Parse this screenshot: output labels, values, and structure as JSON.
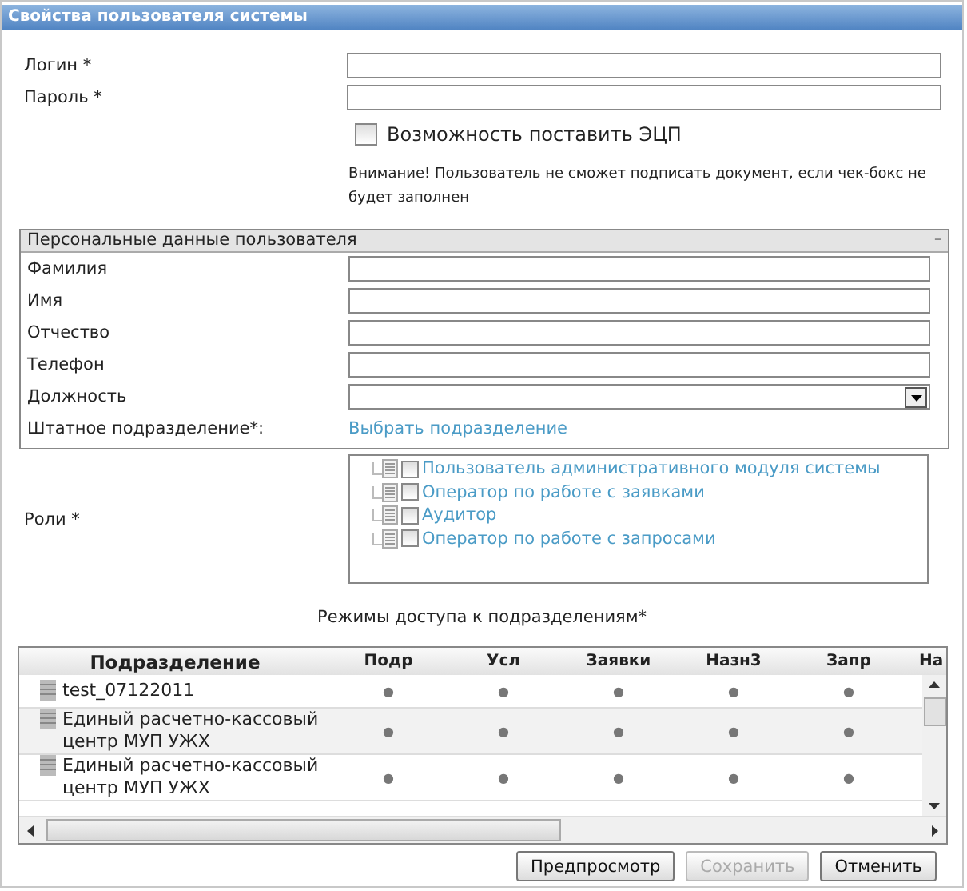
{
  "window": {
    "title": "Свойства пользователя системы"
  },
  "login": {
    "label": "Логин *"
  },
  "password": {
    "label": "Пароль *"
  },
  "signature": {
    "label": "Возможность поставить ЭЦП",
    "checked": false
  },
  "warning": "Внимание! Пользователь не сможет подписать документ, если чек-бокс не будет заполнен",
  "personal": {
    "title": "Персональные данные пользователя",
    "collapse": "–",
    "fields": [
      {
        "label": "Фамилия",
        "kind": "text"
      },
      {
        "label": "Имя",
        "kind": "text"
      },
      {
        "label": "Отчество",
        "kind": "text"
      },
      {
        "label": "Телефон",
        "kind": "text"
      },
      {
        "label": "Должность",
        "kind": "select"
      },
      {
        "label": "Штатное подразделение*:",
        "kind": "link",
        "link": "Выбрать подразделение"
      }
    ]
  },
  "roles": {
    "label": "Роли *",
    "items": [
      {
        "label": "Пользователь административного модуля системы",
        "checked": false
      },
      {
        "label": "Оператор по работе с заявками",
        "checked": false
      },
      {
        "label": "Аудитор",
        "checked": false
      },
      {
        "label": "Оператор по работе с запросами",
        "checked": false
      }
    ]
  },
  "access": {
    "title": "Режимы доступа к подразделениям*",
    "columns": [
      "Подразделение",
      "Подр",
      "Усл",
      "Заявки",
      "Назн3",
      "Запр",
      "На"
    ],
    "rows": [
      {
        "cells": [
          "test_07122011",
          "●",
          "●",
          "●",
          "●",
          "●"
        ]
      },
      {
        "cells": [
          "Единый расчетно-кассовый центр МУП УЖХ",
          "●",
          "●",
          "●",
          "●",
          "●"
        ]
      },
      {
        "cells": [
          "Единый расчетно-кассовый центр МУП УЖХ",
          "●",
          "●",
          "●",
          "●",
          "●"
        ]
      }
    ]
  },
  "buttons": [
    {
      "label": "Предпросмотр",
      "disabled": false
    },
    {
      "label": "Сохранить",
      "disabled": true
    },
    {
      "label": "Отменить",
      "disabled": false
    }
  ]
}
